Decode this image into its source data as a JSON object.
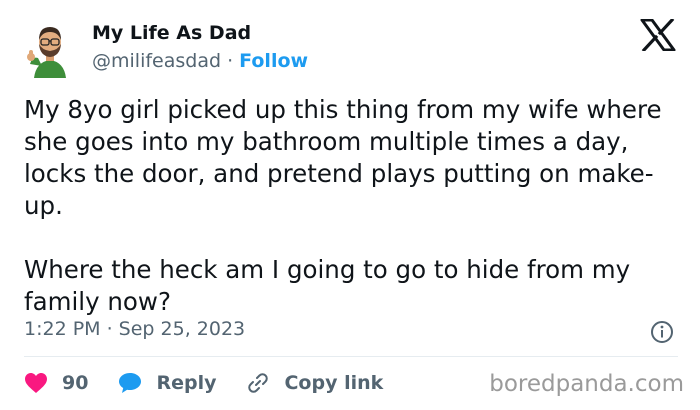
{
  "author": {
    "name": "My Life As Dad",
    "handle": "@milifeasdad",
    "separator": "·",
    "follow_label": "Follow",
    "avatar_icon": "bitmoji-dad-thumbs-up-avatar"
  },
  "platform_icon": "x-logo-icon",
  "tweet": {
    "paragraphs": [
      "My 8yo girl picked up this thing from my wife where she goes into my bathroom multiple times a day, locks the door, and pretend plays putting on make-up.",
      "Where the heck am I going to go to hide from my family now?"
    ],
    "timestamp": "1:22 PM · Sep 25, 2023"
  },
  "actions": {
    "likes_count": "90",
    "reply_label": "Reply",
    "copy_link_label": "Copy link"
  },
  "watermark": "boredpanda.com",
  "colors": {
    "follow": "#1d9bf0",
    "heart": "#f91880",
    "reply_bubble": "#1d9bf0",
    "muted_text": "#536471"
  }
}
